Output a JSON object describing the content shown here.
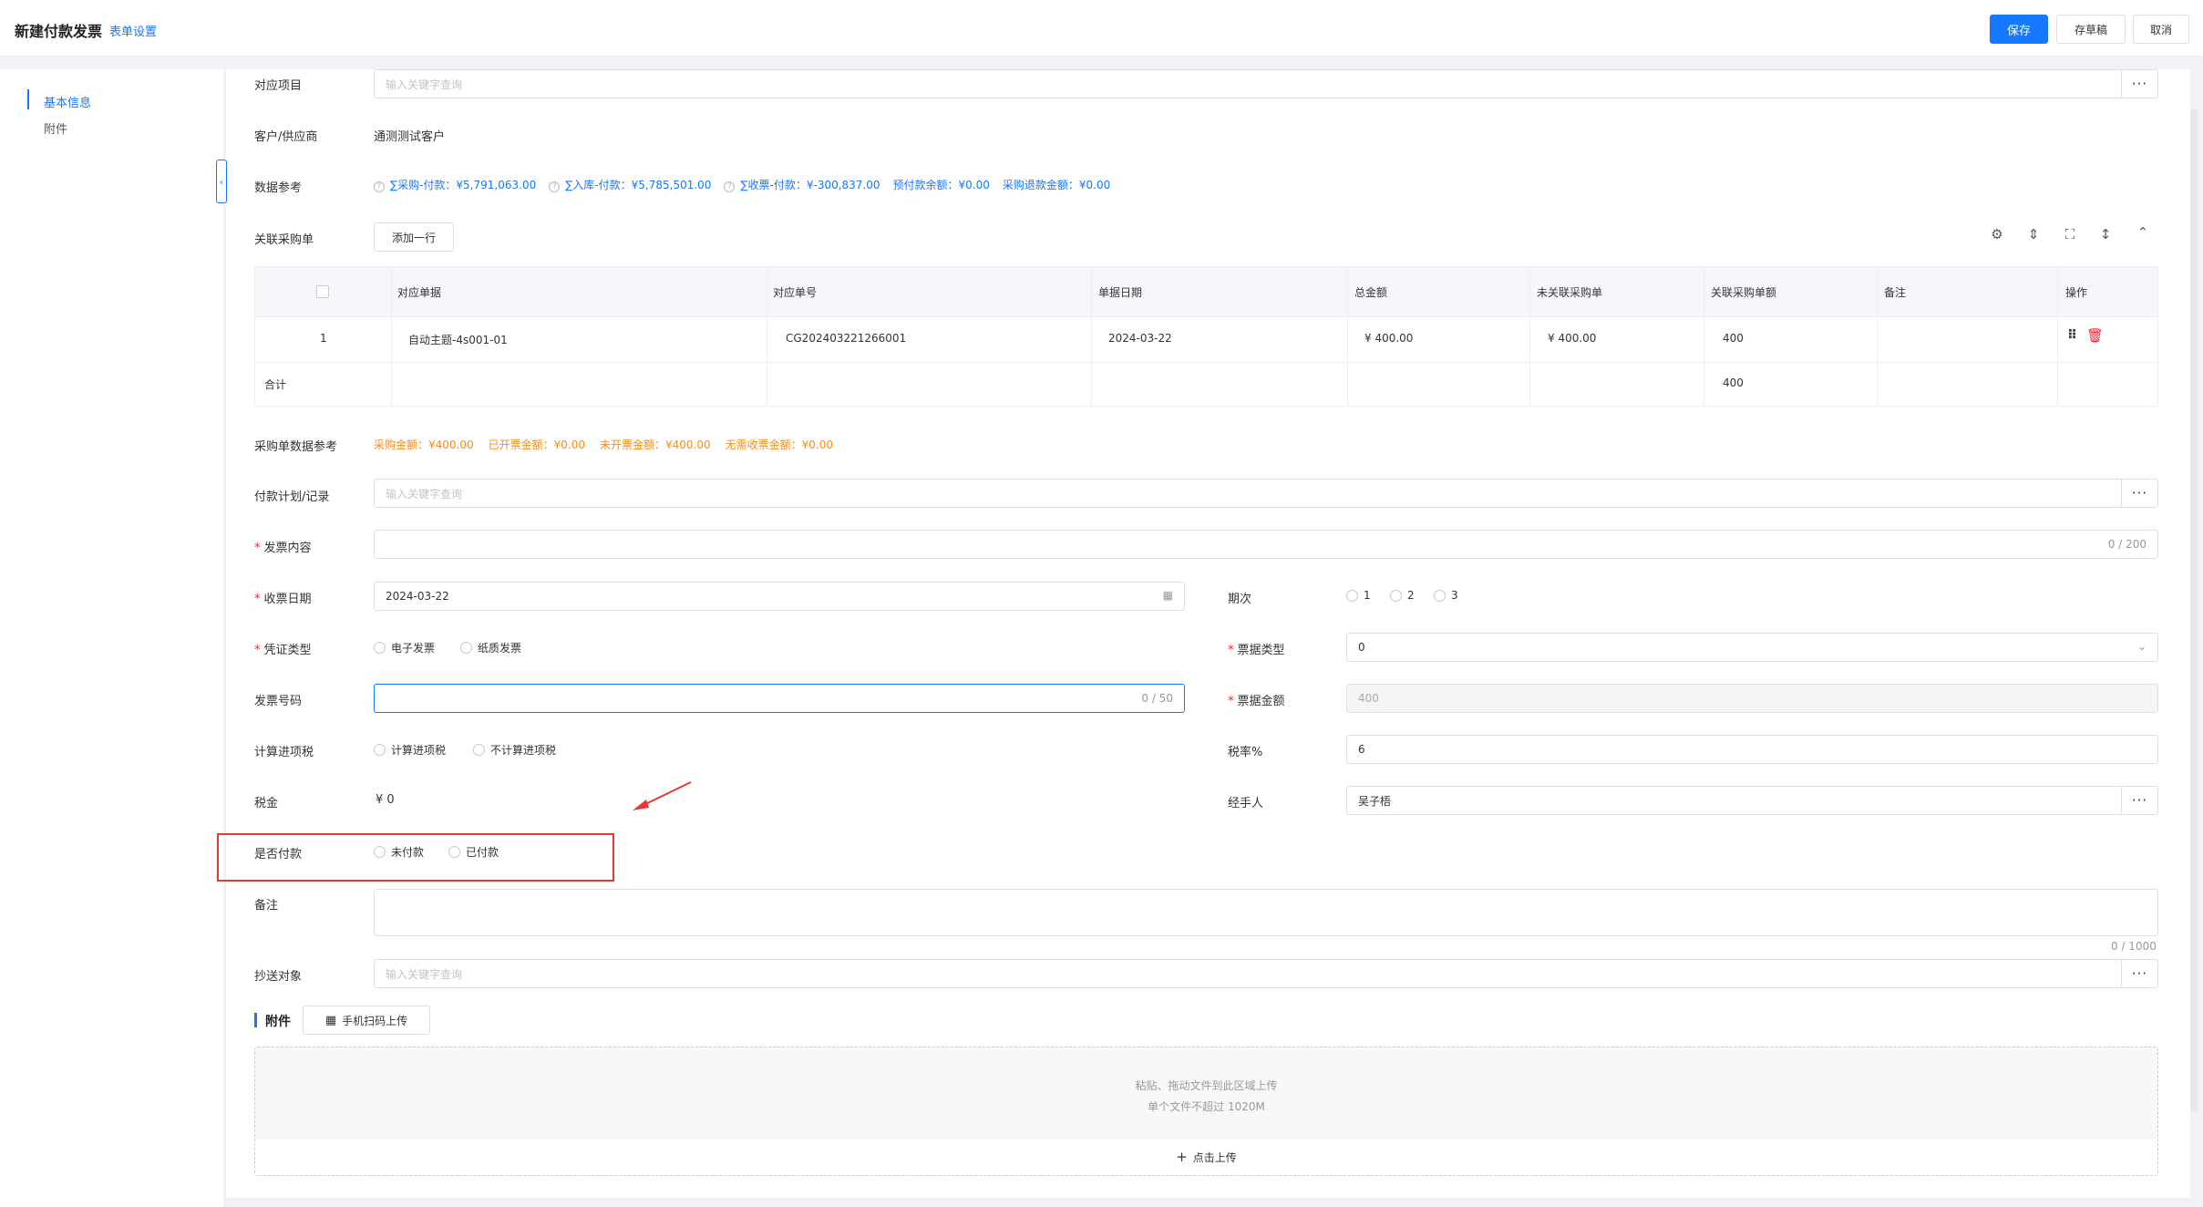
{
  "header": {
    "title": "新建付款发票",
    "form_settings_link": "表单设置",
    "save_label": "保存",
    "draft_label": "存草稿",
    "cancel_label": "取消"
  },
  "sidebar": {
    "items": [
      {
        "label": "基本信息",
        "active": true
      },
      {
        "label": "附件",
        "active": false
      }
    ]
  },
  "form": {
    "project": {
      "label": "对应项目",
      "placeholder": "输入关键字查询"
    },
    "customer": {
      "label": "客户/供应商",
      "value": "通测测试客户"
    },
    "data_ref": {
      "label": "数据参考",
      "items": [
        "∑采购-付款：¥5,791,063.00",
        "∑入库-付款：¥5,785,501.00",
        "∑收票-付款：¥-300,837.00",
        "预付款余额：¥0.00",
        "采购退款金额：¥0.00"
      ]
    },
    "purchase_orders": {
      "label": "关联采购单",
      "add_row_label": "添加一行",
      "columns": [
        "对应单据",
        "对应单号",
        "单据日期",
        "总金额",
        "未关联采购单",
        "关联采购单额",
        "备注",
        "操作"
      ],
      "rows": [
        {
          "index": "1",
          "doc": "自动主题-4s001-01",
          "doc_no": "CG202403221266001",
          "date": "2024-03-22",
          "total": "¥ 400.00",
          "unlinked": "¥ 400.00",
          "linked": "400",
          "remark": ""
        }
      ],
      "total_label": "合计",
      "total_linked": "400"
    },
    "po_data_ref": {
      "label": "采购单数据参考",
      "items": [
        "采购金额：¥400.00",
        "已开票金额：¥0.00",
        "未开票金额：¥400.00",
        "无需收票金额：¥0.00"
      ]
    },
    "payment_plan": {
      "label": "付款计划/记录",
      "placeholder": "输入关键字查询"
    },
    "invoice_content": {
      "label": "发票内容",
      "counter": "0 / 200"
    },
    "receive_date": {
      "label": "收票日期",
      "value": "2024-03-22"
    },
    "period": {
      "label": "期次",
      "options": [
        "1",
        "2",
        "3"
      ]
    },
    "voucher_type": {
      "label": "凭证类型",
      "options": [
        "电子发票",
        "纸质发票"
      ]
    },
    "ticket_type": {
      "label": "票据类型",
      "value": "0"
    },
    "invoice_no": {
      "label": "发票号码",
      "counter": "0 / 50"
    },
    "ticket_amount": {
      "label": "票据金额",
      "value": "400"
    },
    "calc_tax": {
      "label": "计算进项税",
      "options": [
        "计算进项税",
        "不计算进项税"
      ]
    },
    "tax_rate": {
      "label": "税率%",
      "value": "6"
    },
    "tax": {
      "label": "税金",
      "value": "¥ 0"
    },
    "handler": {
      "label": "经手人",
      "value": "吴子梧"
    },
    "paid": {
      "label": "是否付款",
      "options": [
        "未付款",
        "已付款"
      ]
    },
    "remark": {
      "label": "备注",
      "counter": "0 / 1000"
    },
    "cc": {
      "label": "抄送对象",
      "placeholder": "输入关键字查询"
    }
  },
  "attachment": {
    "title": "附件",
    "scan_label": "手机扫码上传",
    "drop_line1": "粘贴、拖动文件到此区域上传",
    "drop_line2": "单个文件不超过 1020M",
    "upload_label": "点击上传"
  },
  "colors": {
    "primary": "#1677ff",
    "required": "#f5222d",
    "orange": "#fa8c16",
    "annotation": "#e53935"
  }
}
